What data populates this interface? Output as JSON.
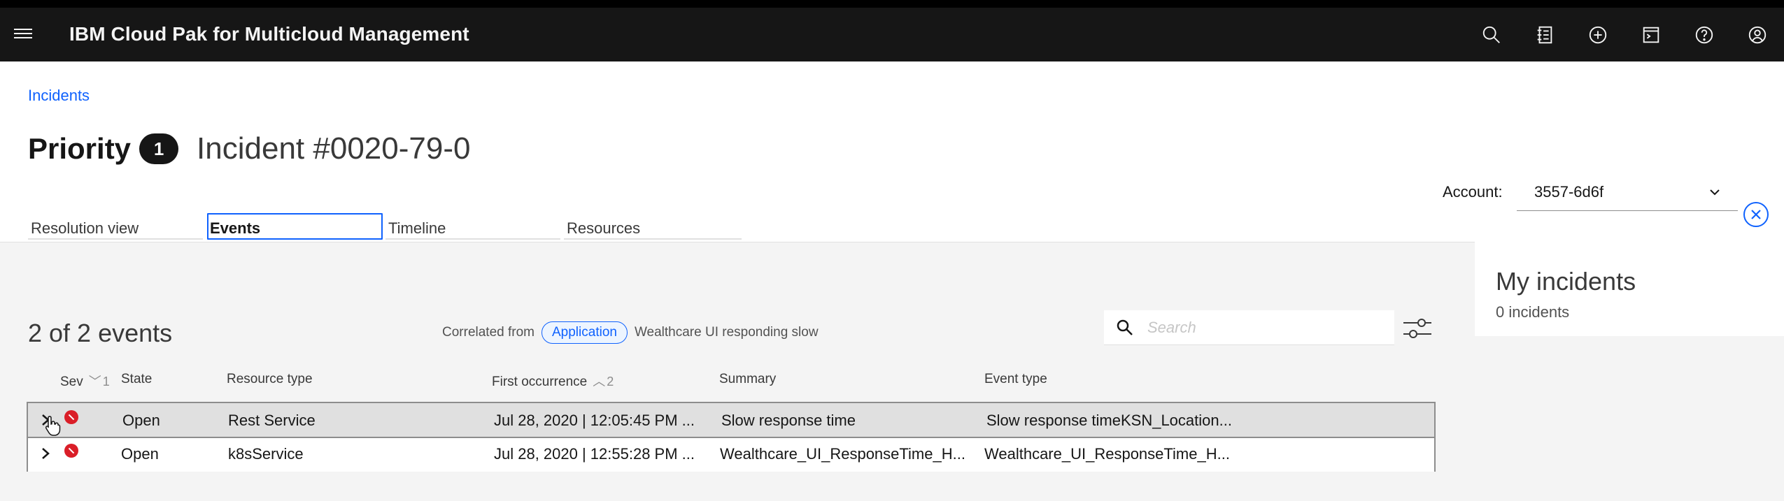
{
  "header": {
    "app_title": "IBM Cloud Pak for Multicloud Management",
    "icons": [
      "menu-icon",
      "search-icon",
      "catalog-icon",
      "add-icon",
      "terminal-icon",
      "help-icon",
      "user-icon"
    ]
  },
  "breadcrumb": {
    "label": "Incidents"
  },
  "incident": {
    "priority_label": "Priority",
    "priority_value": "1",
    "id": "Incident #0020-79-0"
  },
  "account": {
    "label": "Account:",
    "value": "3557-6d6f"
  },
  "tabs": [
    {
      "label": "Resolution view",
      "active": false
    },
    {
      "label": "Events",
      "active": true
    },
    {
      "label": "Timeline",
      "active": false
    },
    {
      "label": "Resources",
      "active": false
    }
  ],
  "my_incidents": {
    "title": "My incidents",
    "count": "0 incidents"
  },
  "events": {
    "count_label": "2 of 2 events",
    "correlated_prefix": "Correlated from",
    "correlated_tag": "Application",
    "correlated_name": "Wealthcare UI responding slow",
    "search_placeholder": "Search",
    "columns": {
      "sev": "Sev",
      "sev_sort": "1",
      "state": "State",
      "resource_type": "Resource type",
      "first_occurrence": "First occurrence",
      "first_occurrence_sort": "2",
      "summary": "Summary",
      "event_type": "Event type"
    },
    "rows": [
      {
        "state": "Open",
        "resource_type": "Rest Service",
        "first_occurrence": "Jul 28, 2020 | 12:05:45 PM ...",
        "summary": "Slow response time",
        "event_type": "Slow response timeKSN_Location..."
      },
      {
        "state": "Open",
        "resource_type": "k8sService",
        "first_occurrence": "Jul 28, 2020 | 12:55:28 PM ...",
        "summary": "Wealthcare_UI_ResponseTime_H...",
        "event_type": "Wealthcare_UI_ResponseTime_H..."
      }
    ]
  },
  "colors": {
    "header_bg": "#161616",
    "accent": "#0f62fe",
    "severity_critical": "#da1e28",
    "content_bg": "#f4f4f4"
  }
}
